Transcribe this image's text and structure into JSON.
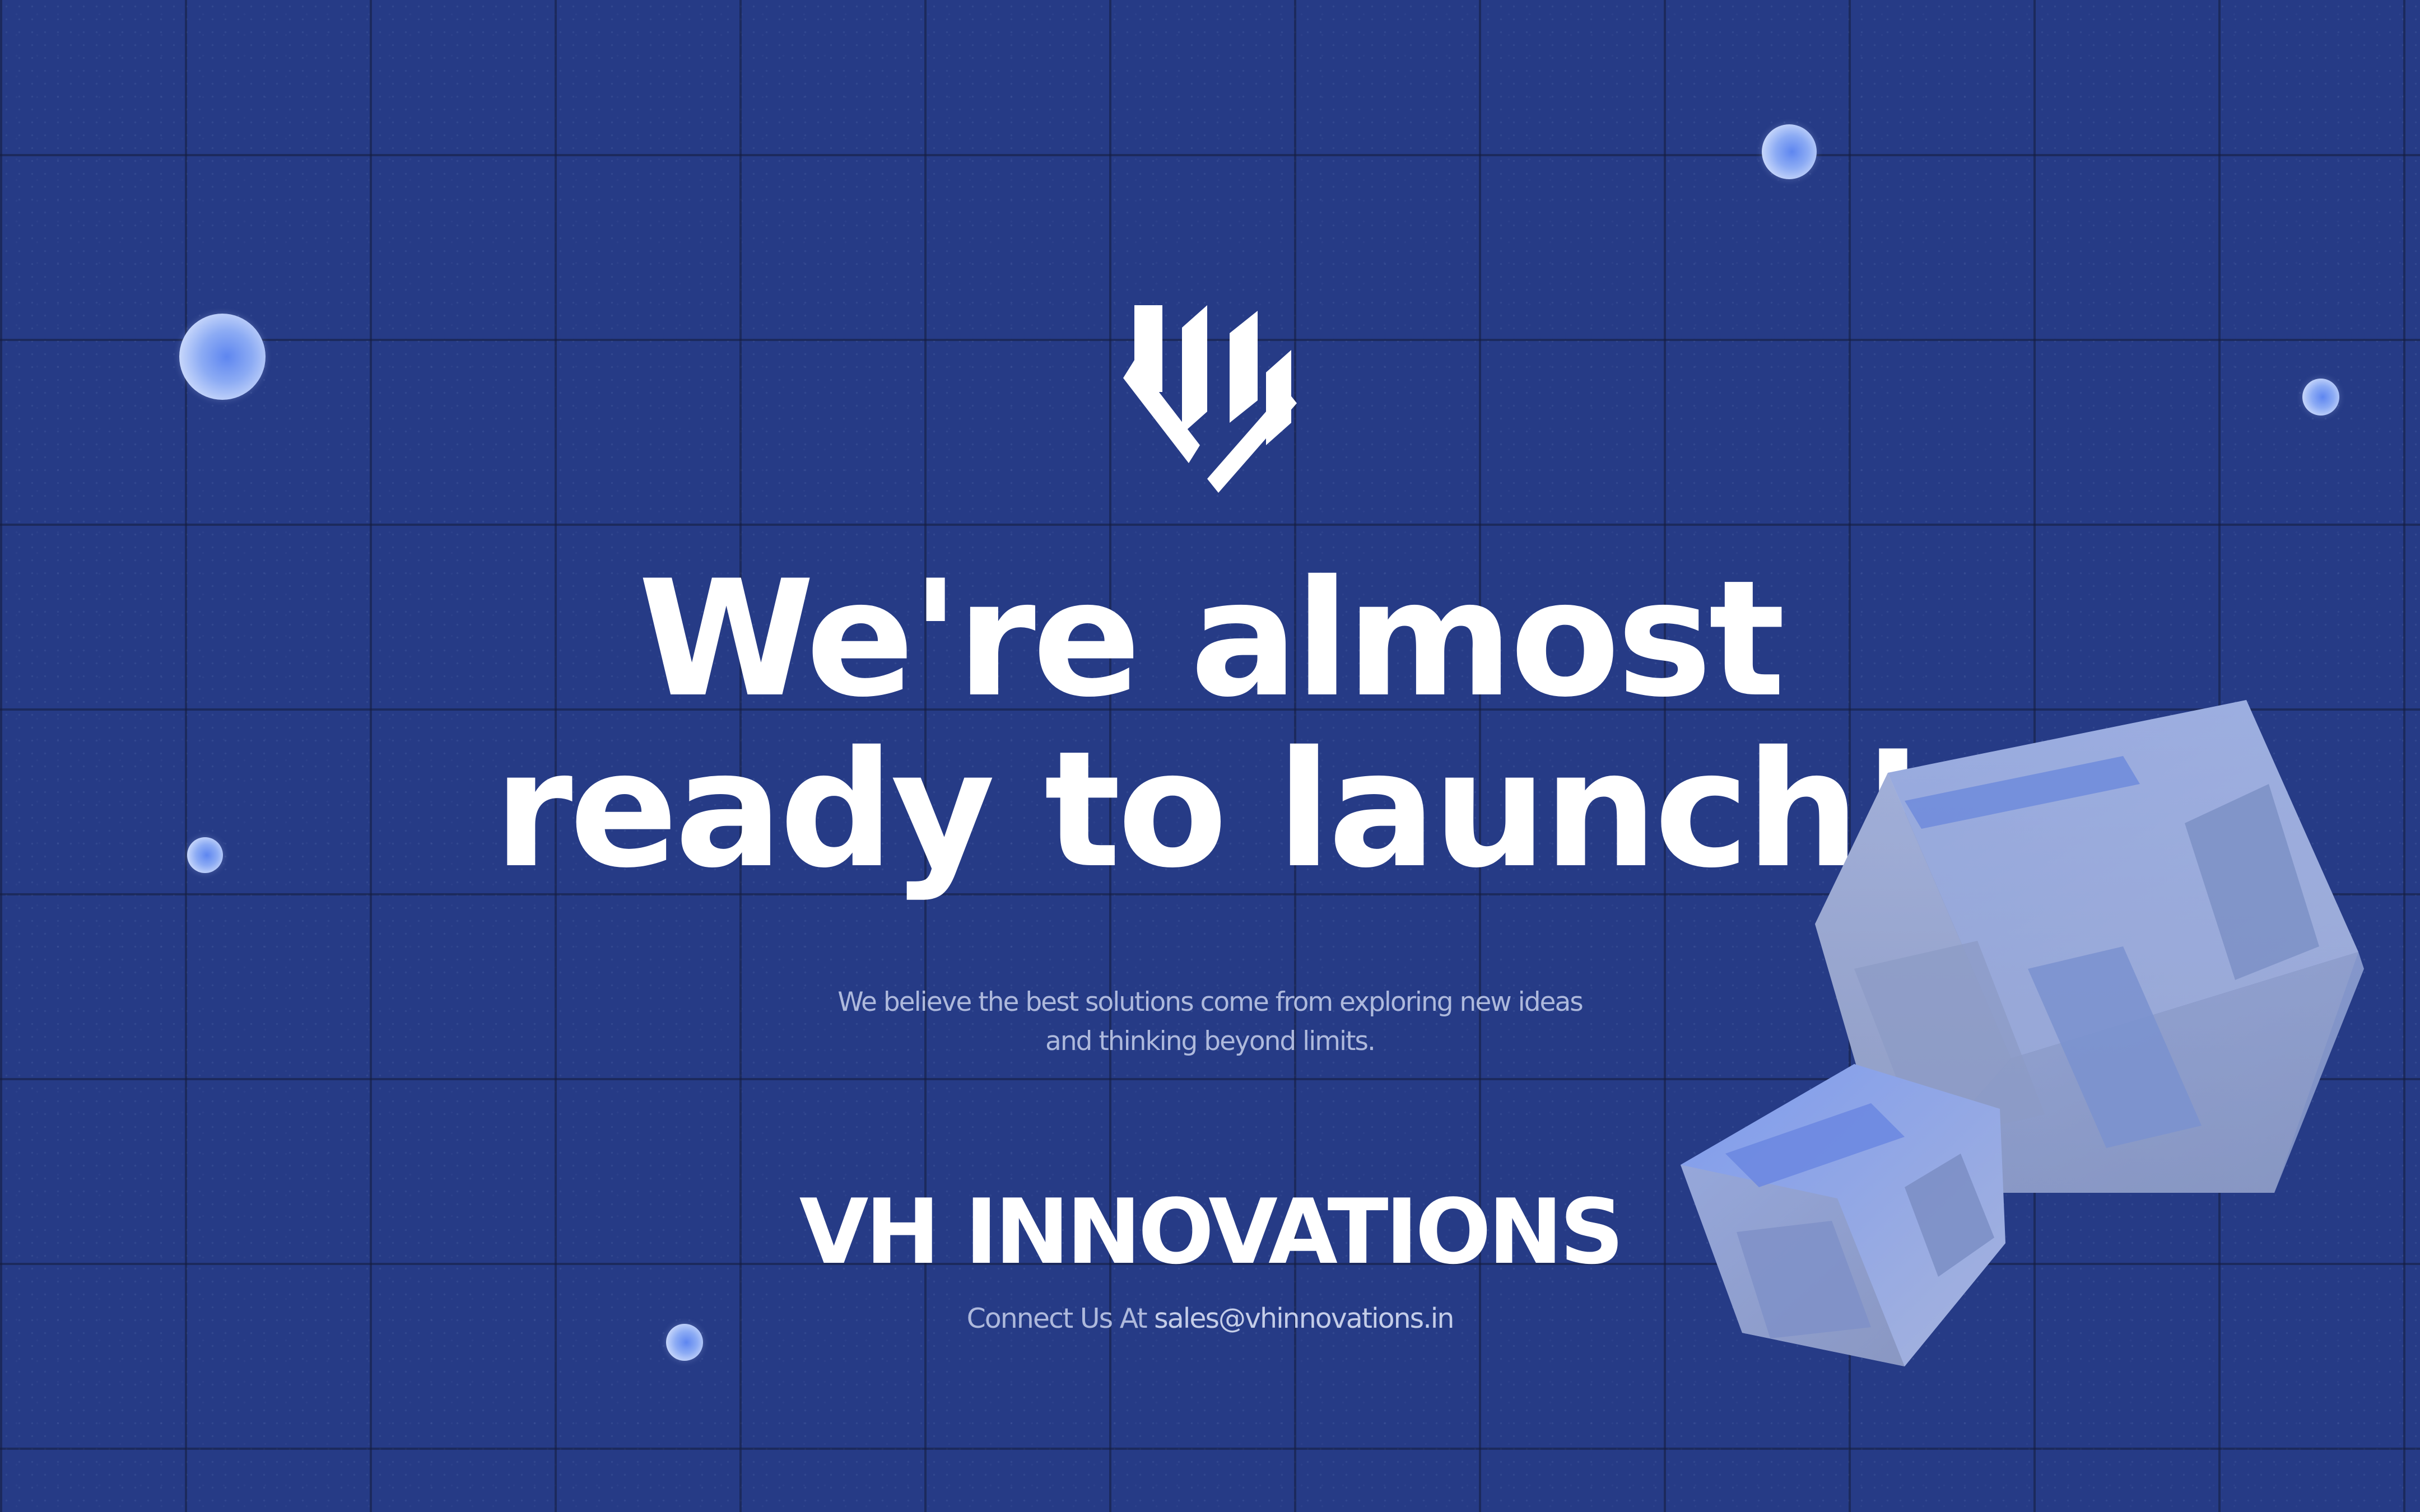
{
  "headline": {
    "line1": "We're almost",
    "line2": "ready to launch!"
  },
  "tagline": {
    "line1": "We believe the best solutions come from exploring new ideas",
    "line2": "and thinking beyond limits."
  },
  "brand": {
    "name": "VH INNOVATIONS",
    "logo_icon": "vh-monogram-logo"
  },
  "contact": {
    "prefix": "Connect Us At",
    "email": "sales@vhinnovations.in"
  },
  "colors": {
    "background": "#263b86",
    "grid_line": "#141c3c",
    "text_primary": "#ffffff",
    "text_muted": "#aeb9dc",
    "cube": "#8fa3dc",
    "bubble": "#8cabf4"
  },
  "decorations": {
    "bubbles": [
      "bubble",
      "bubble",
      "bubble",
      "bubble",
      "bubble"
    ],
    "cubes": [
      "large-3d-cube",
      "small-3d-cube"
    ]
  }
}
